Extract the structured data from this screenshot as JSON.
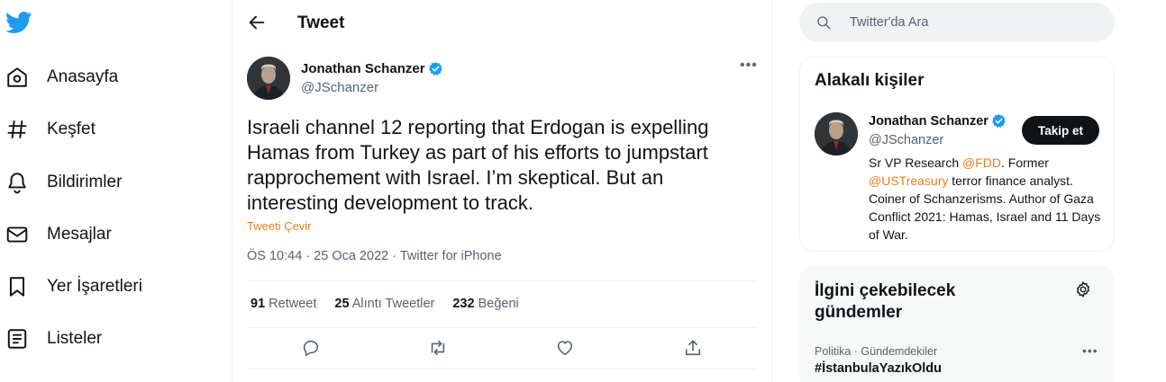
{
  "nav": {
    "items": [
      {
        "label": "Anasayfa",
        "icon": "home-icon"
      },
      {
        "label": "Keşfet",
        "icon": "hashtag-icon"
      },
      {
        "label": "Bildirimler",
        "icon": "bell-icon"
      },
      {
        "label": "Mesajlar",
        "icon": "mail-icon"
      },
      {
        "label": "Yer İşaretleri",
        "icon": "bookmark-icon"
      },
      {
        "label": "Listeler",
        "icon": "list-icon"
      }
    ]
  },
  "header": {
    "title": "Tweet"
  },
  "tweet": {
    "author_name": "Jonathan Schanzer",
    "author_handle": "@JSchanzer",
    "text": "Israeli channel 12 reporting that Erdogan is expelling Hamas from Turkey as part of his efforts to jumpstart rapprochement with Israel. I’m skeptical. But an interesting development to track.",
    "translate_label": "Tweeti Çevir",
    "time": "ÖS 10:44",
    "date": "25 Oca 2022",
    "source": "Twitter for iPhone",
    "separator": " · ",
    "stats": {
      "retweets_count": "91",
      "retweets_label": " Retweet",
      "quotes_count": "25",
      "quotes_label": " Alıntı Tweetler",
      "likes_count": "232",
      "likes_label": " Beğeni"
    }
  },
  "search": {
    "placeholder": "Twitter'da Ara"
  },
  "related": {
    "title": "Alakalı kişiler",
    "person_name": "Jonathan Schanzer",
    "person_handle": "@JSchanzer",
    "follow_label": "Takip et",
    "bio_1": "Sr VP Research ",
    "bio_mention_1": "@FDD",
    "bio_2": ". Former ",
    "bio_mention_2": "@USTreasury",
    "bio_3": " terror finance analyst. Coiner of Schanzerisms. Author of Gaza Conflict 2021: Hamas, Israel and 11 Days of War."
  },
  "trends": {
    "title": "İlgini çekebilecek gündemler",
    "items": [
      {
        "context": "Politika · Gündemdekiler",
        "name": "#İstanbulaYazıkOldu"
      }
    ]
  },
  "colors": {
    "brand": "#1d9bf0",
    "link": "#e8811c",
    "text": "#0f1419",
    "muted": "#536471"
  }
}
